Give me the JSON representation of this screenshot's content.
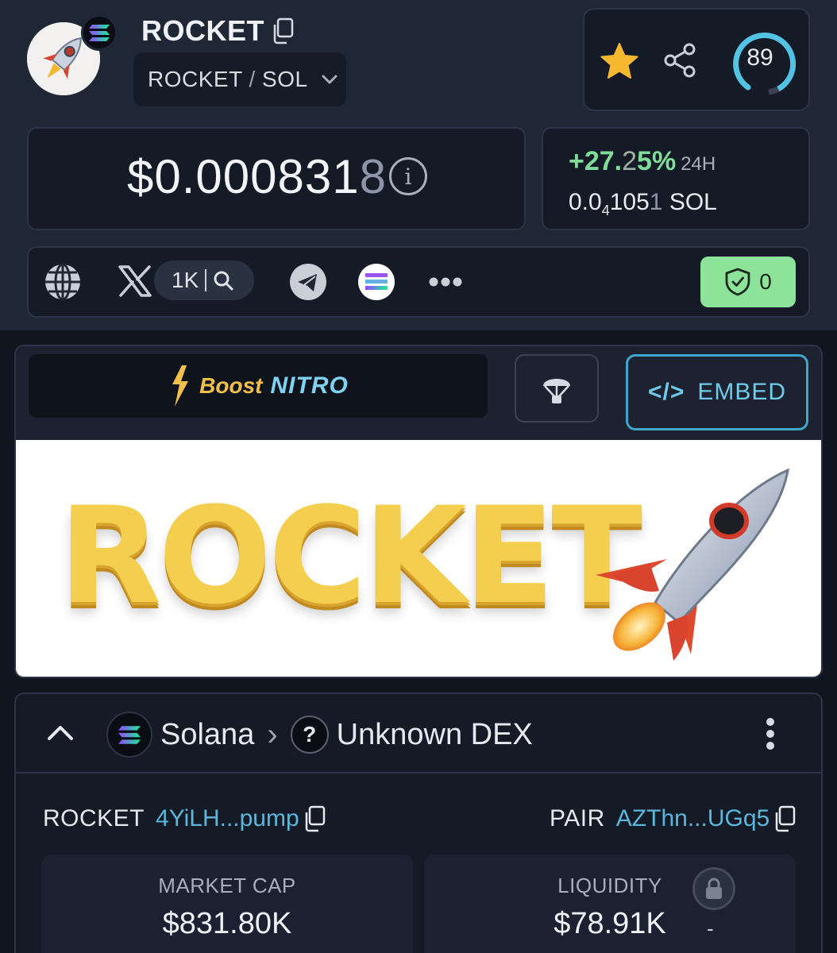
{
  "header": {
    "token_name": "ROCKET",
    "pair_base": "ROCKET",
    "pair_separator": "/",
    "pair_quote": "SOL",
    "trust_score": "89"
  },
  "price": {
    "usd_main": "$0.000831",
    "usd_tail": "8",
    "info_glyph": "i",
    "change_main": "+27.",
    "change_dim": "2",
    "change_tail": "5%",
    "timeframe": "24H",
    "sol_prefix": "0.0",
    "sol_sub": "4",
    "sol_mid": "105",
    "sol_tail": "1",
    "sol_unit": "SOL"
  },
  "socials": {
    "x_followers": "1K",
    "audit_count": "0"
  },
  "actions": {
    "boost_label": "Boost",
    "boost_brand": "NITRO",
    "embed_label": "EMBED",
    "embed_code_glyph": "</>"
  },
  "banner": {
    "text": "ROCKET"
  },
  "pair_info": {
    "chain": "Solana",
    "dex": "Unknown DEX",
    "dex_glyph": "?",
    "token_label": "ROCKET",
    "token_address": "4YiLH...pump",
    "pair_label": "PAIR",
    "pair_address": "AZThn...UGq5"
  },
  "stats": {
    "market_cap_label": "MARKET CAP",
    "market_cap_value": "$831.80K",
    "liquidity_label": "LIQUIDITY",
    "liquidity_value": "$78.91K",
    "liquidity_extra": "-"
  },
  "colors": {
    "background": "#1f2634",
    "card": "#141a26",
    "positive": "#7fdc9a",
    "accent_cyan": "#3fa7c9",
    "star": "#f5b82e",
    "shield_button": "#8ee39a"
  }
}
